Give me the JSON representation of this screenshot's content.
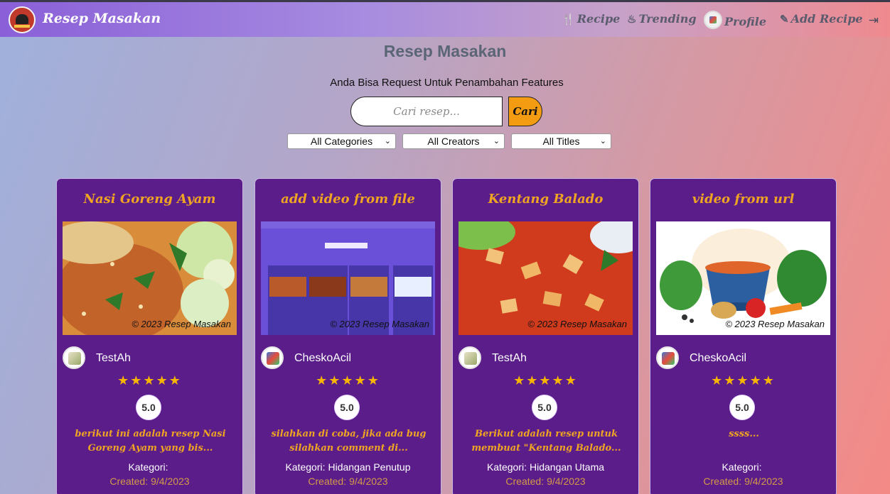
{
  "brand": {
    "name": "Resep Masakan",
    "logo_icon": "chef-hat-icon"
  },
  "nav": {
    "items": [
      {
        "label": "Recipe",
        "icon": "utensils-icon"
      },
      {
        "label": "Trending",
        "icon": "fire-icon"
      },
      {
        "label": "Profile",
        "icon": "avatar"
      },
      {
        "label": "Add Recipe",
        "icon": "pencil-icon"
      }
    ],
    "logout_icon": "sign-out-icon"
  },
  "hero": {
    "title": "Resep Masakan",
    "subtitle": "Anda Bisa Request Untuk Penambahan Features"
  },
  "search": {
    "placeholder": "Cari resep...",
    "value": "",
    "button_label": "Cari"
  },
  "filters": [
    {
      "selected": "All Categories"
    },
    {
      "selected": "All Creators"
    },
    {
      "selected": "All Titles"
    }
  ],
  "copyright": "© 2023 Resep Masakan",
  "kategori_label": "Kategori:",
  "created_label": "Created:",
  "colors": {
    "card_bg": "#5a1d8a",
    "accent": "#f0a522",
    "button": "#f39c12"
  },
  "recipes": [
    {
      "title": "Nasi Goreng Ayam",
      "author": "TestAh",
      "rating": 5,
      "rating_text": "5.0",
      "description": "berikut ini adalah resep Nasi Goreng Ayam yang bis...",
      "category": "",
      "created": "9/4/2023"
    },
    {
      "title": "add video from file",
      "author": "CheskoAcil",
      "rating": 5,
      "rating_text": "5.0",
      "description": "silahkan di coba, jika ada bug silahkan comment di...",
      "category": "Hidangan Penutup",
      "created": "9/4/2023"
    },
    {
      "title": "Kentang Balado",
      "author": "TestAh",
      "rating": 5,
      "rating_text": "5.0",
      "description": "Berikut adalah resep untuk membuat \"Kentang Balado...",
      "category": "Hidangan Utama",
      "created": "9/4/2023"
    },
    {
      "title": "video from url",
      "author": "CheskoAcil",
      "rating": 5,
      "rating_text": "5.0",
      "description": "ssss...",
      "category": "",
      "created": "9/4/2023"
    }
  ]
}
